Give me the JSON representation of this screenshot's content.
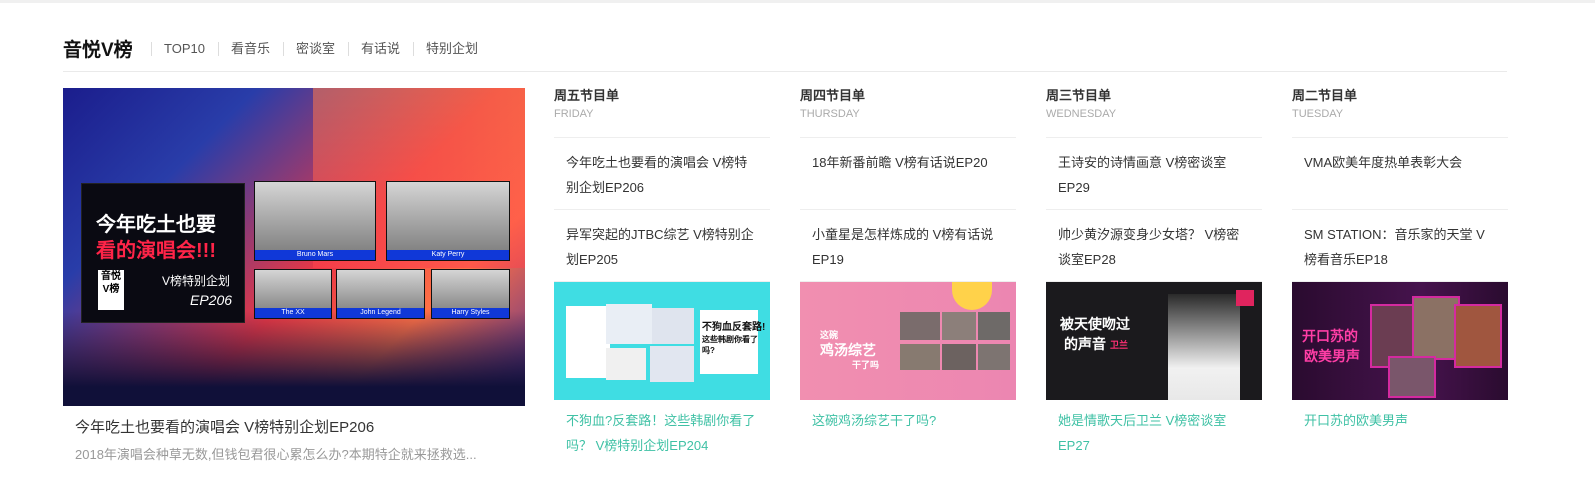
{
  "header": {
    "brand": "音悦V榜",
    "nav": [
      "TOP10",
      "看音乐",
      "密谈室",
      "有话说",
      "特别企划"
    ]
  },
  "featured": {
    "poster": {
      "line1": "今年吃土也要",
      "line2": "看的演唱会!!!",
      "series": "V榜特别企划",
      "episode": "EP206",
      "logo_text": "音悦V榜"
    },
    "artists": [
      "Bruno Mars",
      "Katy Perry",
      "The XX",
      "John Legend",
      "Harry Styles"
    ],
    "title": "今年吃土也要看的演唱会 V榜特别企划EP206",
    "description": "2018年演唱会种草无数,但钱包君很心累怎么办?本期特企就来拯救选..."
  },
  "columns": [
    {
      "day": "周五节目单",
      "day_en": "FRIDAY",
      "episodes": [
        "今年吃土也要看的演唱会 V榜特别企划EP206",
        "异军突起的JTBC综艺 V榜特别企划EP205"
      ],
      "thumb_title": "不狗血?反套路！这些韩剧你看了吗？ V榜特别企划EP204",
      "thumb_text": [
        "不狗血反套路!",
        "这些韩剧你看了吗?"
      ]
    },
    {
      "day": "周四节目单",
      "day_en": "THURSDAY",
      "episodes": [
        "18年新番前瞻 V榜有话说EP20",
        "小童星是怎样炼成的 V榜有话说EP19"
      ],
      "thumb_title": "这碗鸡汤综艺干了吗?",
      "thumb_text": [
        "这碗",
        "鸡汤综艺",
        "干了吗"
      ]
    },
    {
      "day": "周三节目单",
      "day_en": "WEDNESDAY",
      "episodes": [
        "王诗安的诗情画意 V榜密谈室EP29",
        "帅少黄汐源变身少女塔？ V榜密谈室EP28"
      ],
      "thumb_title": "她是情歌天后卫兰 V榜密谈室EP27",
      "thumb_text": [
        "被天使吻过",
        "的声音",
        "卫兰"
      ]
    },
    {
      "day": "周二节目单",
      "day_en": "TUESDAY",
      "episodes": [
        "VMA欧美年度热单表彰大会",
        "SM STATION：音乐家的天堂 V榜看音乐EP18"
      ],
      "thumb_title": "开口苏的欧美男声",
      "thumb_text": [
        "开口苏的",
        "欧美男声"
      ]
    }
  ]
}
